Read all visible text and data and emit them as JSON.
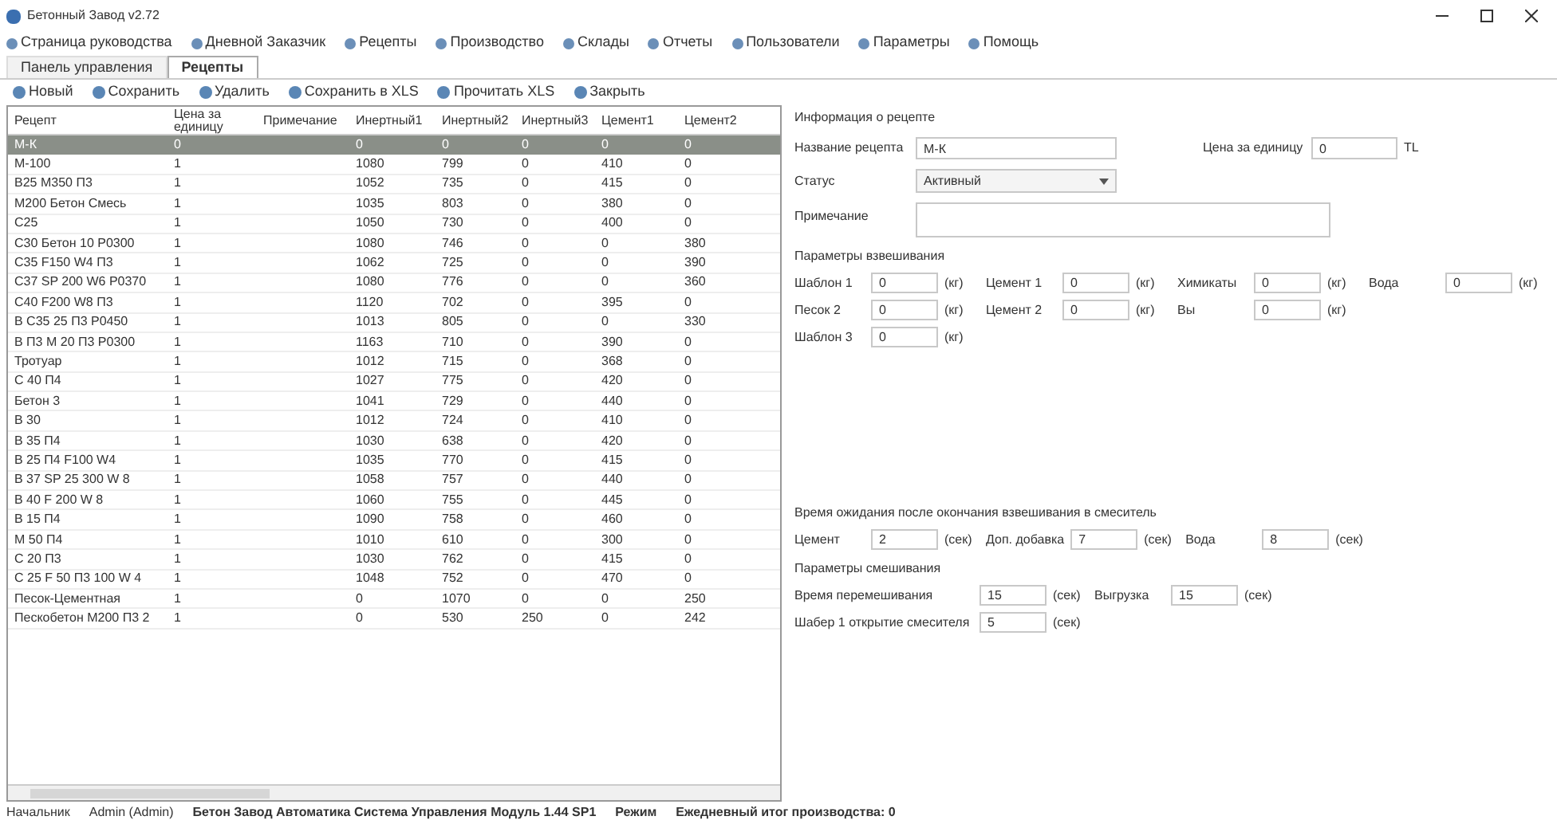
{
  "window": {
    "title": "Бетонный Завод v2.72"
  },
  "menu": [
    "Страница руководства",
    "Дневной Заказчик",
    "Рецепты",
    "Производство",
    "Склады",
    "Отчеты",
    "Пользователи",
    "Параметры",
    "Помощь"
  ],
  "tabs": [
    {
      "label": "Панель управления",
      "selected": false
    },
    {
      "label": "Рецепты",
      "selected": true
    }
  ],
  "toolbar": [
    "Новый",
    "Сохранить",
    "Удалить",
    "Сохранить в XLS",
    "Прочитать XLS",
    "Закрыть"
  ],
  "table": {
    "columns": [
      "Рецепт",
      "Цена за единицу",
      "Примечание",
      "Инертный1",
      "Инертный2",
      "Инертный3",
      "Цемент1",
      "Цемент2"
    ],
    "rows": [
      {
        "selected": true,
        "cells": [
          "М-К",
          "0",
          "",
          "0",
          "0",
          "0",
          "0",
          "0"
        ]
      },
      {
        "selected": false,
        "cells": [
          "М-100",
          "1",
          "",
          "1080",
          "799",
          "0",
          "410",
          "0"
        ]
      },
      {
        "selected": false,
        "cells": [
          "В25 М350 П3",
          "1",
          "",
          "1052",
          "735",
          "0",
          "415",
          "0"
        ]
      },
      {
        "selected": false,
        "cells": [
          "М200 Бетон Смесь",
          "1",
          "",
          "1035",
          "803",
          "0",
          "380",
          "0"
        ]
      },
      {
        "selected": false,
        "cells": [
          "С25",
          "1",
          "",
          "1050",
          "730",
          "0",
          "400",
          "0"
        ]
      },
      {
        "selected": false,
        "cells": [
          "С30 Бетон 10 Р0300",
          "1",
          "",
          "1080",
          "746",
          "0",
          "0",
          "380"
        ]
      },
      {
        "selected": false,
        "cells": [
          "С35 F150 W4 П3",
          "1",
          "",
          "1062",
          "725",
          "0",
          "0",
          "390"
        ]
      },
      {
        "selected": false,
        "cells": [
          "С37 SP 200 W6 Р0370",
          "1",
          "",
          "1080",
          "776",
          "0",
          "0",
          "360"
        ]
      },
      {
        "selected": false,
        "cells": [
          "С40 F200 W8 П3",
          "1",
          "",
          "1120",
          "702",
          "0",
          "395",
          "0"
        ]
      },
      {
        "selected": false,
        "cells": [
          "В С35 25 П3 Р0450",
          "1",
          "",
          "1013",
          "805",
          "0",
          "0",
          "330"
        ]
      },
      {
        "selected": false,
        "cells": [
          "В П3 М 20 П3 Р0300",
          "1",
          "",
          "1163",
          "710",
          "0",
          "390",
          "0"
        ]
      },
      {
        "selected": false,
        "cells": [
          "Тротуар",
          "1",
          "",
          "1012",
          "715",
          "0",
          "368",
          "0"
        ]
      },
      {
        "selected": false,
        "cells": [
          "С 40 П4",
          "1",
          "",
          "1027",
          "775",
          "0",
          "420",
          "0"
        ]
      },
      {
        "selected": false,
        "cells": [
          "Бетон 3",
          "1",
          "",
          "1041",
          "729",
          "0",
          "440",
          "0"
        ]
      },
      {
        "selected": false,
        "cells": [
          "В 30",
          "1",
          "",
          "1012",
          "724",
          "0",
          "410",
          "0"
        ]
      },
      {
        "selected": false,
        "cells": [
          "В 35 П4",
          "1",
          "",
          "1030",
          "638",
          "0",
          "420",
          "0"
        ]
      },
      {
        "selected": false,
        "cells": [
          "В 25 П4 F100 W4",
          "1",
          "",
          "1035",
          "770",
          "0",
          "415",
          "0"
        ]
      },
      {
        "selected": false,
        "cells": [
          "В 37 SP 25 300 W 8",
          "1",
          "",
          "1058",
          "757",
          "0",
          "440",
          "0"
        ]
      },
      {
        "selected": false,
        "cells": [
          "В 40 F 200 W 8",
          "1",
          "",
          "1060",
          "755",
          "0",
          "445",
          "0"
        ]
      },
      {
        "selected": false,
        "cells": [
          "В 15 П4",
          "1",
          "",
          "1090",
          "758",
          "0",
          "460",
          "0"
        ]
      },
      {
        "selected": false,
        "cells": [
          "М 50 П4",
          "1",
          "",
          "1010",
          "610",
          "0",
          "300",
          "0"
        ]
      },
      {
        "selected": false,
        "cells": [
          "С 20 П3",
          "1",
          "",
          "1030",
          "762",
          "0",
          "415",
          "0"
        ]
      },
      {
        "selected": false,
        "cells": [
          "С 25 F 50 П3 100 W 4",
          "1",
          "",
          "1048",
          "752",
          "0",
          "470",
          "0"
        ]
      },
      {
        "selected": false,
        "cells": [
          "Песок-Цементная",
          "1",
          "",
          "0",
          "1070",
          "0",
          "0",
          "250"
        ]
      },
      {
        "selected": false,
        "cells": [
          "Пескобетон М200 П3 2",
          "1",
          "",
          "0",
          "530",
          "250",
          "0",
          "242"
        ]
      }
    ]
  },
  "info": {
    "heading": "Информация о рецепте",
    "name_label": "Название рецепта",
    "name_value": "М-К",
    "price_label": "Цена за единицу",
    "price_value": "0",
    "currency": "TL",
    "status_label": "Статус",
    "status_value": "Активный",
    "note_label": "Примечание"
  },
  "weighing": {
    "heading": "Параметры взвешивания",
    "rows": [
      [
        {
          "label": "Шаблон 1",
          "value": "0",
          "unit": "(кг)"
        },
        {
          "label": "Цемент 1",
          "value": "0",
          "unit": "(кг)"
        },
        {
          "label": "Химикаты",
          "value": "0",
          "unit": "(кг)"
        },
        {
          "label": "Вода",
          "value": "0",
          "unit": "(кг)"
        }
      ],
      [
        {
          "label": "Песок 2",
          "value": "0",
          "unit": "(кг)"
        },
        {
          "label": "Цемент 2",
          "value": "0",
          "unit": "(кг)"
        },
        {
          "label": "Вы",
          "value": "0",
          "unit": "(кг)"
        }
      ],
      [
        {
          "label": "Шаблон 3",
          "value": "0",
          "unit": "(кг)"
        }
      ]
    ]
  },
  "waiting": {
    "heading": "Время ожидания после окончания взвешивания в смеситель",
    "rows": [
      [
        {
          "label": "Цемент",
          "value": "2",
          "unit": "(сек)"
        },
        {
          "label": "Доп. добавка",
          "value": "7",
          "unit": "(сек)"
        },
        {
          "label": "Вода",
          "value": "8",
          "unit": "(сек)"
        }
      ]
    ]
  },
  "mixing": {
    "heading": "Параметры смешивания",
    "rows": [
      [
        {
          "label": "Время перемешивания",
          "value": "15",
          "unit": "(сек)"
        },
        {
          "label": "Выгрузка",
          "value": "15",
          "unit": "(сек)"
        }
      ],
      [
        {
          "label": "Шабер 1 открытие смесителя",
          "value": "5",
          "unit": "(сек)"
        }
      ]
    ]
  },
  "status_bar": [
    "Начальник",
    "Admin (Admin)",
    "Бетон Завод Автоматика Система Управления Модуль 1.44 SP1",
    "Режим",
    "Ежедневный итог производства: 0"
  ]
}
